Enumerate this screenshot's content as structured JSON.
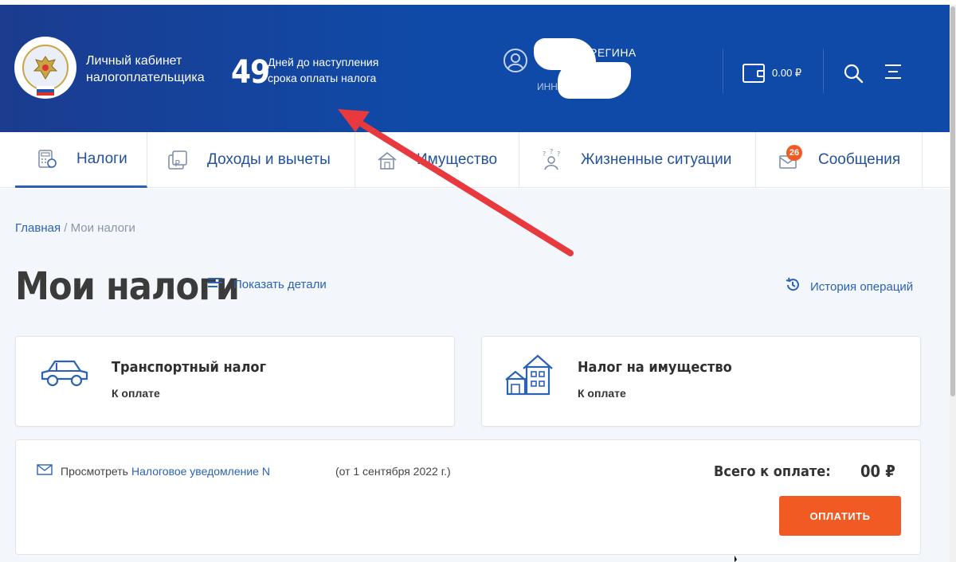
{
  "header": {
    "cabinet_line1": "Личный кабинет",
    "cabinet_line2": "налогоплательщика",
    "days_count": "49",
    "days_line1": "Дней до наступления",
    "days_line2": "срока оплаты налога",
    "user_name_partial": "РЕГИНА",
    "inn_label": "ИНН",
    "balance": "0.00 ₽"
  },
  "nav": {
    "tabs": [
      {
        "label": "Налоги",
        "icon": "calculator-icon",
        "active": true
      },
      {
        "label": "Доходы и вычеты",
        "icon": "ruble-document-icon"
      },
      {
        "label": "Имущество",
        "icon": "property-icon"
      },
      {
        "label": "Жизненные ситуации",
        "icon": "person-question-icon"
      },
      {
        "label": "Сообщения",
        "icon": "envelope-icon",
        "badge": "26"
      }
    ]
  },
  "breadcrumb": {
    "home": "Главная",
    "separator": " / ",
    "current": "Мои налоги"
  },
  "page": {
    "title": "Мои налоги",
    "show_details": "Показать детали",
    "history": "История операций"
  },
  "cards": [
    {
      "title": "Транспортный налог",
      "subtitle": "К оплате",
      "icon": "car-icon"
    },
    {
      "title": "Налог на имущество",
      "subtitle": "К оплате",
      "icon": "house-icon"
    }
  ],
  "notice": {
    "view_text": "Просмотреть",
    "link_text": "Налоговое уведомление N",
    "date_text": "(от 1 сентября 2022 г.)",
    "total_label": "Всего к оплате:",
    "total_value": "00 ₽",
    "pay_button": "ОПЛАТИТЬ"
  },
  "colors": {
    "header_bg": "#0f4aa8",
    "link": "#2b62b8",
    "accent_orange": "#f15a22",
    "annotation_arrow": "#e8393f"
  }
}
